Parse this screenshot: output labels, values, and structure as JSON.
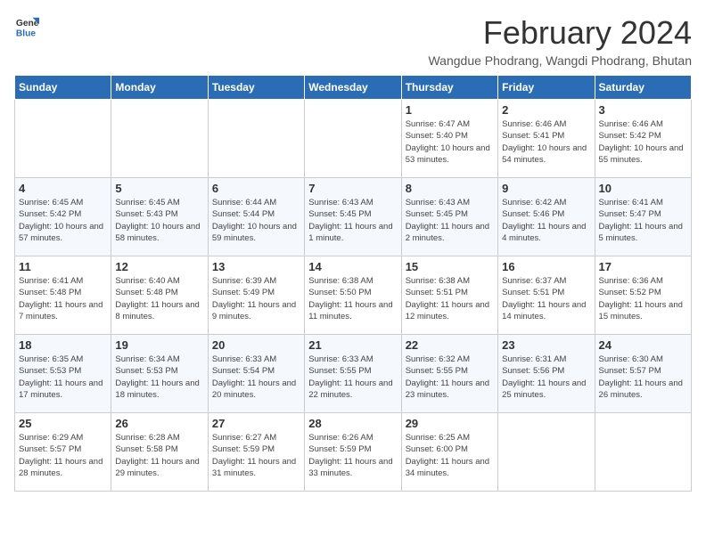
{
  "logo": {
    "text_general": "General",
    "text_blue": "Blue"
  },
  "header": {
    "title": "February 2024",
    "subtitle": "Wangdue Phodrang, Wangdi Phodrang, Bhutan"
  },
  "weekdays": [
    "Sunday",
    "Monday",
    "Tuesday",
    "Wednesday",
    "Thursday",
    "Friday",
    "Saturday"
  ],
  "weeks": [
    [
      {
        "date": "",
        "info": ""
      },
      {
        "date": "",
        "info": ""
      },
      {
        "date": "",
        "info": ""
      },
      {
        "date": "",
        "info": ""
      },
      {
        "date": "1",
        "info": "Sunrise: 6:47 AM\nSunset: 5:40 PM\nDaylight: 10 hours and 53 minutes."
      },
      {
        "date": "2",
        "info": "Sunrise: 6:46 AM\nSunset: 5:41 PM\nDaylight: 10 hours and 54 minutes."
      },
      {
        "date": "3",
        "info": "Sunrise: 6:46 AM\nSunset: 5:42 PM\nDaylight: 10 hours and 55 minutes."
      }
    ],
    [
      {
        "date": "4",
        "info": "Sunrise: 6:45 AM\nSunset: 5:42 PM\nDaylight: 10 hours and 57 minutes."
      },
      {
        "date": "5",
        "info": "Sunrise: 6:45 AM\nSunset: 5:43 PM\nDaylight: 10 hours and 58 minutes."
      },
      {
        "date": "6",
        "info": "Sunrise: 6:44 AM\nSunset: 5:44 PM\nDaylight: 10 hours and 59 minutes."
      },
      {
        "date": "7",
        "info": "Sunrise: 6:43 AM\nSunset: 5:45 PM\nDaylight: 11 hours and 1 minute."
      },
      {
        "date": "8",
        "info": "Sunrise: 6:43 AM\nSunset: 5:45 PM\nDaylight: 11 hours and 2 minutes."
      },
      {
        "date": "9",
        "info": "Sunrise: 6:42 AM\nSunset: 5:46 PM\nDaylight: 11 hours and 4 minutes."
      },
      {
        "date": "10",
        "info": "Sunrise: 6:41 AM\nSunset: 5:47 PM\nDaylight: 11 hours and 5 minutes."
      }
    ],
    [
      {
        "date": "11",
        "info": "Sunrise: 6:41 AM\nSunset: 5:48 PM\nDaylight: 11 hours and 7 minutes."
      },
      {
        "date": "12",
        "info": "Sunrise: 6:40 AM\nSunset: 5:48 PM\nDaylight: 11 hours and 8 minutes."
      },
      {
        "date": "13",
        "info": "Sunrise: 6:39 AM\nSunset: 5:49 PM\nDaylight: 11 hours and 9 minutes."
      },
      {
        "date": "14",
        "info": "Sunrise: 6:38 AM\nSunset: 5:50 PM\nDaylight: 11 hours and 11 minutes."
      },
      {
        "date": "15",
        "info": "Sunrise: 6:38 AM\nSunset: 5:51 PM\nDaylight: 11 hours and 12 minutes."
      },
      {
        "date": "16",
        "info": "Sunrise: 6:37 AM\nSunset: 5:51 PM\nDaylight: 11 hours and 14 minutes."
      },
      {
        "date": "17",
        "info": "Sunrise: 6:36 AM\nSunset: 5:52 PM\nDaylight: 11 hours and 15 minutes."
      }
    ],
    [
      {
        "date": "18",
        "info": "Sunrise: 6:35 AM\nSunset: 5:53 PM\nDaylight: 11 hours and 17 minutes."
      },
      {
        "date": "19",
        "info": "Sunrise: 6:34 AM\nSunset: 5:53 PM\nDaylight: 11 hours and 18 minutes."
      },
      {
        "date": "20",
        "info": "Sunrise: 6:33 AM\nSunset: 5:54 PM\nDaylight: 11 hours and 20 minutes."
      },
      {
        "date": "21",
        "info": "Sunrise: 6:33 AM\nSunset: 5:55 PM\nDaylight: 11 hours and 22 minutes."
      },
      {
        "date": "22",
        "info": "Sunrise: 6:32 AM\nSunset: 5:55 PM\nDaylight: 11 hours and 23 minutes."
      },
      {
        "date": "23",
        "info": "Sunrise: 6:31 AM\nSunset: 5:56 PM\nDaylight: 11 hours and 25 minutes."
      },
      {
        "date": "24",
        "info": "Sunrise: 6:30 AM\nSunset: 5:57 PM\nDaylight: 11 hours and 26 minutes."
      }
    ],
    [
      {
        "date": "25",
        "info": "Sunrise: 6:29 AM\nSunset: 5:57 PM\nDaylight: 11 hours and 28 minutes."
      },
      {
        "date": "26",
        "info": "Sunrise: 6:28 AM\nSunset: 5:58 PM\nDaylight: 11 hours and 29 minutes."
      },
      {
        "date": "27",
        "info": "Sunrise: 6:27 AM\nSunset: 5:59 PM\nDaylight: 11 hours and 31 minutes."
      },
      {
        "date": "28",
        "info": "Sunrise: 6:26 AM\nSunset: 5:59 PM\nDaylight: 11 hours and 33 minutes."
      },
      {
        "date": "29",
        "info": "Sunrise: 6:25 AM\nSunset: 6:00 PM\nDaylight: 11 hours and 34 minutes."
      },
      {
        "date": "",
        "info": ""
      },
      {
        "date": "",
        "info": ""
      }
    ]
  ]
}
